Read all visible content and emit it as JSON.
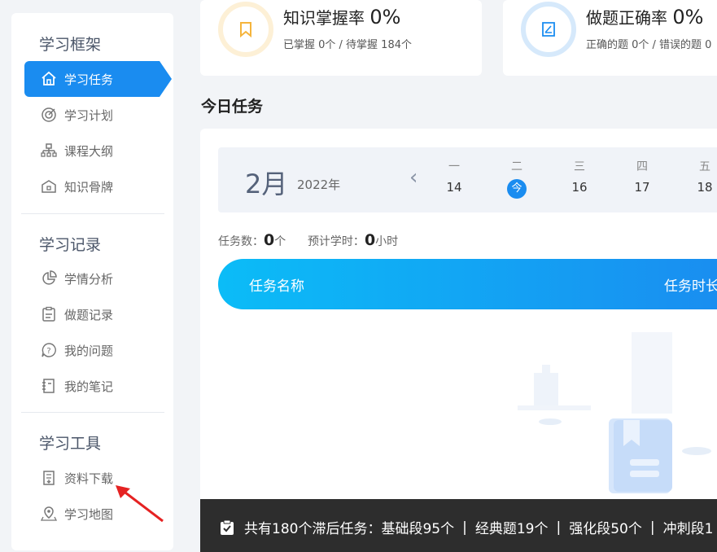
{
  "sidebar": {
    "sections": [
      {
        "title": "学习框架"
      },
      {
        "title": "学习记录"
      },
      {
        "title": "学习工具"
      }
    ],
    "items": [
      {
        "label": "学习任务",
        "icon": "home-icon",
        "active": true
      },
      {
        "label": "学习计划",
        "icon": "target-icon"
      },
      {
        "label": "课程大纲",
        "icon": "org-chart-icon"
      },
      {
        "label": "知识骨牌",
        "icon": "domino-icon"
      },
      {
        "label": "学情分析",
        "icon": "pie-chart-icon"
      },
      {
        "label": "做题记录",
        "icon": "clipboard-icon"
      },
      {
        "label": "我的问题",
        "icon": "question-icon"
      },
      {
        "label": "我的笔记",
        "icon": "note-icon"
      },
      {
        "label": "资料下载",
        "icon": "download-doc-icon"
      },
      {
        "label": "学习地图",
        "icon": "map-icon"
      }
    ],
    "accent": "#1a8cf0"
  },
  "stats": {
    "knowledge": {
      "title": "知识掌握率",
      "value": "0%",
      "sub": "已掌握 0个 / 待掌握 184个",
      "color": "#f5b43c"
    },
    "accuracy": {
      "title": "做题正确率",
      "value": "0%",
      "sub": "正确的题 0个 / 错误的题 0",
      "color": "#1a8cf0"
    }
  },
  "today": {
    "title": "今日任务",
    "month": "2月",
    "year": "2022年",
    "days": [
      {
        "weekday": "一",
        "date": "14"
      },
      {
        "weekday": "二",
        "date": "今",
        "today": true
      },
      {
        "weekday": "三",
        "date": "16"
      },
      {
        "weekday": "四",
        "date": "17"
      },
      {
        "weekday": "五",
        "date": "18"
      }
    ],
    "task_count_label": "任务数：",
    "task_count": "0",
    "task_count_unit": "个",
    "est_label": "预计学时：",
    "est_value": "0",
    "est_unit": "小时",
    "columns": [
      "任务名称",
      "任务时长"
    ]
  },
  "notice": {
    "prefix": "共有180个滞后任务：",
    "parts": [
      "基础段95个",
      "经典题19个",
      "强化段50个",
      "冲刺段1"
    ],
    "separator": "|"
  }
}
